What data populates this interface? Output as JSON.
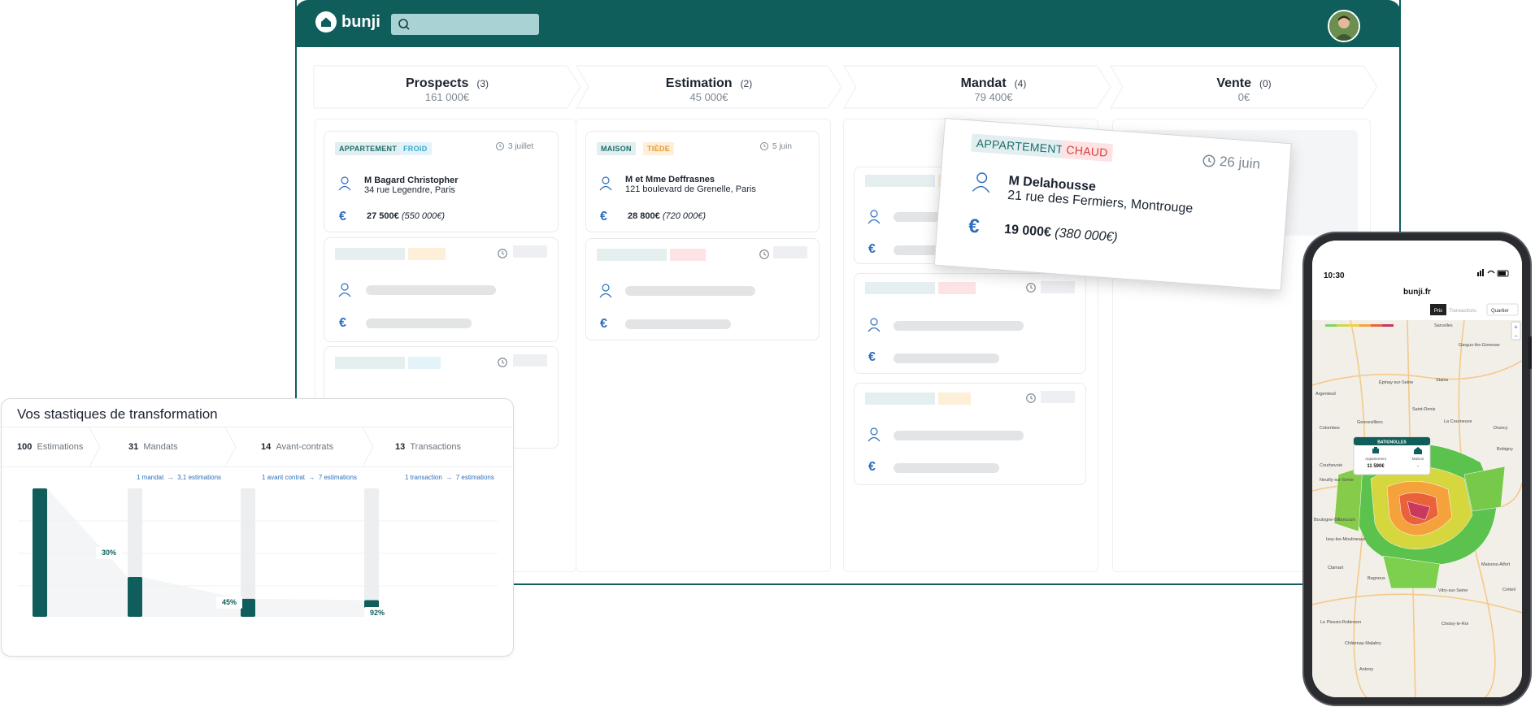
{
  "brand": {
    "name": "bunji",
    "accent": "#0f5e5b"
  },
  "pipeline": {
    "stages": [
      {
        "name": "Prospects",
        "count": "(3)",
        "amount": "161 000€"
      },
      {
        "name": "Estimation",
        "count": "(2)",
        "amount": "45 000€"
      },
      {
        "name": "Mandat",
        "count": "(4)",
        "amount": "79 400€"
      },
      {
        "name": "Vente",
        "count": "(0)",
        "amount": "0€"
      }
    ],
    "prospect_card": {
      "type": "APPARTEMENT",
      "temp": "FROID",
      "date": "3 juillet",
      "name": "M Bagard Christopher",
      "address": "34 rue Legendre, Paris",
      "fee": "27 500€",
      "price": "(550 000€)"
    },
    "estimation_card": {
      "type": "MAISON",
      "temp": "TIÈDE",
      "date": "5 juin",
      "name": "M et Mme Deffrasnes",
      "address": "121 boulevard de Grenelle, Paris",
      "fee": "28 800€",
      "price": "(720 000€)"
    },
    "mandat_card": {
      "type": "APPARTEMENT",
      "temp": "CHAUD",
      "date": "26 juin",
      "name": "M Delahousse",
      "address": "21 rue des Fermiers, Montrouge",
      "fee": "19 000€",
      "price": "(380 000€)"
    }
  },
  "stats": {
    "title": "Vos stastiques de transformation",
    "steps": [
      {
        "count": "100",
        "label": "Estimations"
      },
      {
        "count": "31",
        "label": "Mandats"
      },
      {
        "count": "14",
        "label": "Avant-contrats"
      },
      {
        "count": "13",
        "label": "Transactions"
      }
    ],
    "ratios": [
      {
        "left": "1 mandat",
        "right": "3,1 estimations"
      },
      {
        "left": "1 avant contrat",
        "right": "7 estimations"
      },
      {
        "left": "1 transaction",
        "right": "7 estimations"
      }
    ],
    "conversions": [
      "30%",
      "45%",
      "92%"
    ],
    "colors": {
      "bar": "#0f5e5b",
      "track": "#eceef0"
    }
  },
  "phone": {
    "time": "10:30",
    "url": "bunji.fr",
    "tabs": [
      "Prix",
      "Transactions"
    ],
    "filter": "Quartier",
    "popup": {
      "title": "BATIGNOLLES",
      "col1": "Appartement",
      "col1_value": "11 590€",
      "col2": "Maison",
      "col2_value": "-"
    },
    "places": [
      "Sarcelles",
      "Gargus-lès-Gonesse",
      "Épinay-sur-Seine",
      "Stains",
      "Argenteuil",
      "Saint-Denis",
      "La Courneuve",
      "Drancy",
      "Colombes",
      "Gennevilliers",
      "Bobigny",
      "Courbevoie",
      "Neuilly-sur-Seine",
      "Boulogne-Billancourt",
      "Issy-les-Moulineaux",
      "Clamart",
      "Bagneux",
      "Vitry-sur-Seine",
      "Maisons-Alfort",
      "Créteil",
      "Le Plessis-Robinson",
      "Châtenay-Malabry",
      "Choisy-le-Roi",
      "Antony"
    ]
  }
}
